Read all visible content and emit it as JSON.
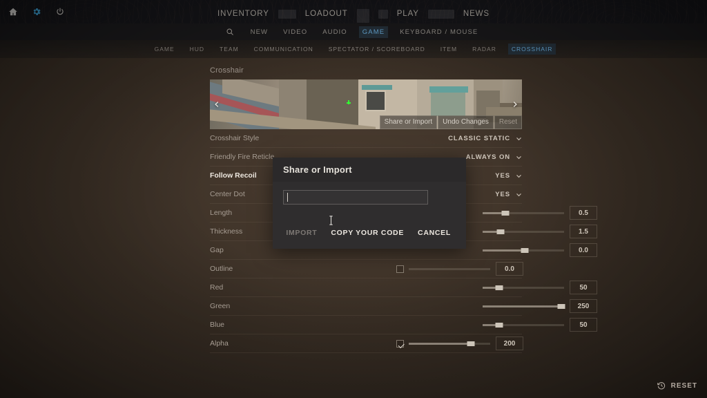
{
  "topbar": {
    "system_icons": [
      {
        "name": "home-icon",
        "label": "Home"
      },
      {
        "name": "gear-icon",
        "label": "Settings"
      },
      {
        "name": "power-icon",
        "label": "Power"
      }
    ],
    "nav": [
      {
        "label": "INVENTORY",
        "type": "item"
      },
      {
        "label": "",
        "type": "skeleton"
      },
      {
        "label": "LOADOUT",
        "type": "item"
      },
      {
        "label": "",
        "type": "skeleton"
      },
      {
        "label": "PLAY",
        "type": "item"
      },
      {
        "label": "",
        "type": "skeleton"
      },
      {
        "label": "NEWS",
        "type": "item"
      }
    ]
  },
  "categories": {
    "search_icon": "search-icon",
    "items": [
      "NEW",
      "VIDEO",
      "AUDIO",
      "GAME",
      "KEYBOARD / MOUSE"
    ],
    "active": "GAME"
  },
  "subtabs": {
    "items": [
      "GAME",
      "HUD",
      "TEAM",
      "COMMUNICATION",
      "SPECTATOR / SCOREBOARD",
      "ITEM",
      "RADAR",
      "CROSSHAIR"
    ],
    "active": "CROSSHAIR"
  },
  "section": {
    "title": "Crosshair"
  },
  "preview": {
    "prev_arrow": "‹",
    "next_arrow": "›",
    "buttons": [
      {
        "label": "Share or Import",
        "dim": false
      },
      {
        "label": "Undo Changes",
        "dim": false
      },
      {
        "label": "Reset",
        "dim": true
      }
    ]
  },
  "settings": {
    "dropdown_rows": [
      {
        "label": "Crosshair Style",
        "value": "CLASSIC STATIC",
        "strong": false
      },
      {
        "label": "Friendly Fire Reticle",
        "value": "ALWAYS ON",
        "strong": false
      },
      {
        "label": "Follow Recoil",
        "value": "YES",
        "strong": true
      },
      {
        "label": "Center Dot",
        "value": "YES",
        "strong": false
      }
    ],
    "slider_rows": [
      {
        "label": "Length",
        "value": "0.5",
        "percent": 28,
        "checkbox": null
      },
      {
        "label": "Thickness",
        "value": "1.5",
        "percent": 22,
        "checkbox": null
      },
      {
        "label": "Gap",
        "value": "0.0",
        "percent": 52,
        "checkbox": null
      },
      {
        "label": "Outline",
        "value": "0.0",
        "percent": 0,
        "checkbox": "off"
      },
      {
        "label": "Red",
        "value": "50",
        "percent": 20,
        "checkbox": null
      },
      {
        "label": "Green",
        "value": "250",
        "percent": 97,
        "checkbox": null
      },
      {
        "label": "Blue",
        "value": "50",
        "percent": 20,
        "checkbox": null
      },
      {
        "label": "Alpha",
        "value": "200",
        "percent": 76,
        "checkbox": "on"
      }
    ]
  },
  "modal": {
    "title": "Share or Import",
    "input_value": "",
    "input_placeholder": "",
    "buttons": [
      {
        "label": "IMPORT",
        "disabled": true
      },
      {
        "label": "COPY YOUR CODE",
        "disabled": false
      },
      {
        "label": "CANCEL",
        "disabled": false
      }
    ]
  },
  "footer": {
    "reset_icon": "history-reset-icon",
    "reset_label": "RESET"
  },
  "colors": {
    "accent_blue": "#6fb6e8",
    "accent_blue_bg": "#27333d",
    "page_bg": "#3b3026",
    "topbar_bg": "#16161a",
    "modal_bg": "#2f2d2e",
    "modal_header_bg": "#2b292a",
    "crosshair_green": "#32fa32"
  }
}
